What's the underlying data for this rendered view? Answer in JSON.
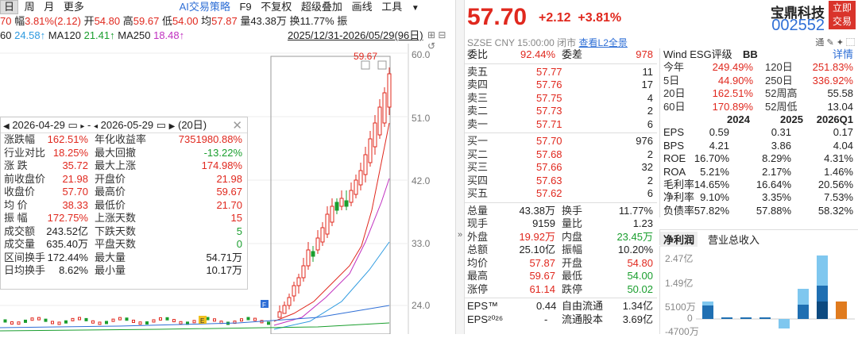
{
  "tabs": [
    "日",
    "周",
    "月",
    "更多"
  ],
  "tabs_right": [
    "AI交易策略",
    "F9",
    "不复权",
    "超级叠加",
    "画线",
    "工具"
  ],
  "quote_line": {
    "prefix": "70",
    "chg_label": "幅",
    "chg": "3.81%(2.12)",
    "open_label": "开",
    "open": "54.80",
    "high_label": "高",
    "high": "59.67",
    "low_label": "低",
    "low": "54.00",
    "avg_label": "均",
    "avg": "57.87",
    "vol_label": "量",
    "vol": "43.38万",
    "turn_label": "换",
    "turn": "11.77%",
    "more": "振"
  },
  "ma_line": {
    "prefix": "60",
    "ma60": "24.58↑",
    "ma120_label": "MA120",
    "ma120": "21.41↑",
    "ma250_label": "MA250",
    "ma250": "18.48↑"
  },
  "range_label": "2025/12/31-2026/05/29(96日)",
  "y_axis": [
    "60.0",
    "51.0",
    "42.0",
    "33.0",
    "24.0"
  ],
  "peak_label": "59.67",
  "stats": {
    "date_from": "2026-04-29",
    "date_to": "2026-05-29",
    "days": "(20日)",
    "rows": [
      [
        "涨跌幅",
        "162.51%",
        "年化收益率",
        "7351980.88%"
      ],
      [
        "行业对比",
        "18.25%",
        "最大回撤",
        "-13.22%"
      ],
      [
        "涨 跌",
        "35.72",
        "最大上涨",
        "174.98%"
      ],
      [
        "前收盘价",
        "21.98",
        "开盘价",
        "21.98"
      ],
      [
        "收盘价",
        "57.70",
        "最高价",
        "59.67"
      ],
      [
        "均 价",
        "38.33",
        "最低价",
        "21.70"
      ],
      [
        "振 幅",
        "172.75%",
        "上涨天数",
        "15"
      ],
      [
        "成交额",
        "243.52亿",
        "下跌天数",
        "5"
      ],
      [
        "成交量",
        "635.40万",
        "平盘天数",
        "0"
      ],
      [
        "区间换手",
        "172.44%",
        "最大量",
        "54.71万"
      ],
      [
        "日均换手",
        "8.62%",
        "最小量",
        "10.17万"
      ]
    ]
  },
  "quote": {
    "price": "57.70",
    "change": "+2.12",
    "change_pct": "+3.81%",
    "name": "宝鼎科技",
    "code": "002552",
    "trade_btn": [
      "立即",
      "交易"
    ],
    "meta": "SZSE CNY 15:00:00 闭市",
    "l2": "查看L2全景",
    "tools": "通 ✎ ✦ ⬚"
  },
  "book": {
    "ratio_label": "委比",
    "ratio": "92.44%",
    "diff_label": "委差",
    "diff": "978",
    "asks": [
      [
        "卖五",
        "57.77",
        "11"
      ],
      [
        "卖四",
        "57.76",
        "17"
      ],
      [
        "卖三",
        "57.75",
        "4"
      ],
      [
        "卖二",
        "57.73",
        "2"
      ],
      [
        "卖一",
        "57.71",
        "6"
      ]
    ],
    "bids": [
      [
        "买一",
        "57.70",
        "976"
      ],
      [
        "买二",
        "57.68",
        "2"
      ],
      [
        "买三",
        "57.66",
        "32"
      ],
      [
        "买四",
        "57.63",
        "2"
      ],
      [
        "买五",
        "57.62",
        "6"
      ]
    ],
    "stats": [
      [
        "总量",
        "43.38万",
        "换手",
        "11.77%"
      ],
      [
        "现手",
        "9159",
        "量比",
        "1.23"
      ],
      [
        "外盘",
        "19.92万",
        "内盘",
        "23.45万"
      ],
      [
        "总额",
        "25.10亿",
        "振幅",
        "10.20%"
      ],
      [
        "均价",
        "57.87",
        "开盘",
        "54.80"
      ],
      [
        "最高",
        "59.67",
        "最低",
        "54.00"
      ],
      [
        "涨停",
        "61.14",
        "跌停",
        "50.02"
      ]
    ],
    "eps": [
      "EPS™",
      "0.44",
      "自由流通",
      "1.34亿"
    ],
    "eps2": [
      "EPS²⁰²⁶",
      "-",
      "流通股本",
      "3.69亿"
    ]
  },
  "fund": {
    "esg_label": "Wind ESG评级",
    "esg": "BB",
    "detail": "详情",
    "returns": [
      [
        "今年",
        "249.49%",
        "120日",
        "251.83%"
      ],
      [
        "5日",
        "44.90%",
        "250日",
        "336.92%"
      ],
      [
        "20日",
        "162.51%",
        "52周高",
        "55.58"
      ],
      [
        "60日",
        "170.89%",
        "52周低",
        "13.04"
      ]
    ],
    "years": [
      "2024",
      "2025",
      "2026Q1"
    ],
    "metrics": [
      [
        "EPS",
        "0.59",
        "0.31",
        "0.17"
      ],
      [
        "BPS",
        "4.21",
        "3.86",
        "4.04"
      ],
      [
        "ROE",
        "16.70%",
        "8.29%",
        "4.31%"
      ],
      [
        "ROA",
        "5.21%",
        "2.17%",
        "1.46%"
      ],
      [
        "毛利率",
        "14.65%",
        "16.64%",
        "20.56%"
      ],
      [
        "净利率",
        "9.10%",
        "3.35%",
        "7.53%"
      ],
      [
        "负债率",
        "57.82%",
        "57.88%",
        "58.32%"
      ]
    ]
  },
  "mini": {
    "tab_active": "净利润",
    "tab2": "营业总收入",
    "ylabels": [
      "2.47亿",
      "1.49亿",
      "5100万",
      "0",
      "-4700万"
    ]
  }
}
